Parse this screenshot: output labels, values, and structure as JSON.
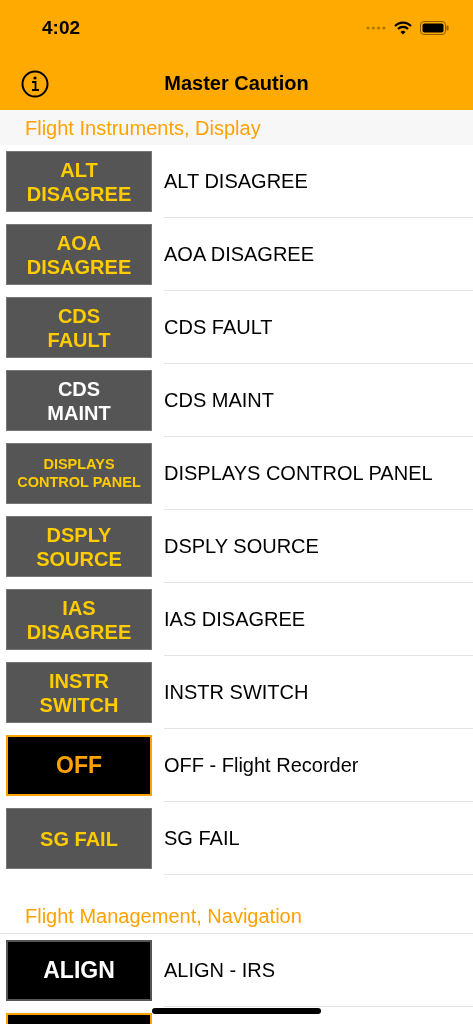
{
  "status_bar": {
    "time": "4:02"
  },
  "nav_bar": {
    "title": "Master Caution"
  },
  "sections": [
    {
      "title": "Flight Instruments, Display",
      "items": [
        {
          "light": {
            "kind": "amber",
            "lines": [
              "ALT",
              "DISAGREE"
            ]
          },
          "label": "ALT DISAGREE"
        },
        {
          "light": {
            "kind": "amber",
            "lines": [
              "AOA",
              "DISAGREE"
            ]
          },
          "label": "AOA DISAGREE"
        },
        {
          "light": {
            "kind": "amber",
            "lines": [
              "CDS",
              "FAULT"
            ]
          },
          "label": "CDS FAULT"
        },
        {
          "light": {
            "kind": "white",
            "lines": [
              "CDS",
              "MAINT"
            ]
          },
          "label": "CDS MAINT"
        },
        {
          "light": {
            "kind": "amber",
            "lines": [
              "DISPLAYS",
              "CONTROL PANEL"
            ]
          },
          "label": "DISPLAYS CONTROL PANEL"
        },
        {
          "light": {
            "kind": "amber",
            "lines": [
              "DSPLY",
              "SOURCE"
            ]
          },
          "label": "DSPLY SOURCE"
        },
        {
          "light": {
            "kind": "amber",
            "lines": [
              "IAS",
              "DISAGREE"
            ]
          },
          "label": "IAS DISAGREE"
        },
        {
          "light": {
            "kind": "amber",
            "lines": [
              "INSTR",
              "SWITCH"
            ]
          },
          "label": "INSTR SWITCH"
        },
        {
          "light": {
            "kind": "amber_lit",
            "lines": [
              "OFF"
            ]
          },
          "label": "OFF - Flight Recorder"
        },
        {
          "light": {
            "kind": "amber",
            "lines": [
              "SG FAIL"
            ]
          },
          "label": "SG FAIL"
        }
      ]
    },
    {
      "title": "Flight Management, Navigation",
      "items": [
        {
          "light": {
            "kind": "white_lit",
            "lines": [
              "ALIGN"
            ]
          },
          "label": "ALIGN - IRS"
        },
        {
          "light": {
            "kind": "amber_lit"
          }
        }
      ]
    }
  ]
}
